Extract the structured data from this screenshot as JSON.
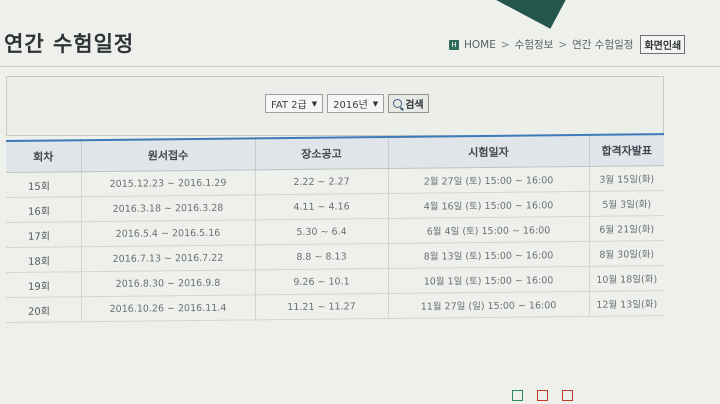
{
  "page": {
    "title": "연간 수험일정"
  },
  "breadcrumb": {
    "home_icon_text": "H",
    "items": [
      "HOME",
      "수험정보",
      "연간 수험일정"
    ],
    "fullscreen_label": "화면인쇄"
  },
  "search": {
    "exam_select": "FAT 2급",
    "year_select": "2016년",
    "button_label": "검색"
  },
  "table": {
    "headers": [
      "회차",
      "원서접수",
      "장소공고",
      "시험일자",
      "합격자발표"
    ],
    "rows": [
      [
        "15회",
        "2015.12.23 ~ 2016.1.29",
        "2.22 ~ 2.27",
        "2월 27일 (토) 15:00 ~ 16:00",
        "3월 15일(화)"
      ],
      [
        "16회",
        "2016.3.18 ~ 2016.3.28",
        "4.11 ~ 4.16",
        "4월 16일 (토) 15:00 ~ 16:00",
        "5월 3일(화)"
      ],
      [
        "17회",
        "2016.5.4 ~ 2016.5.16",
        "5.30 ~ 6.4",
        "6월 4일 (토) 15:00 ~ 16:00",
        "6월 21일(화)"
      ],
      [
        "18회",
        "2016.7.13 ~ 2016.7.22",
        "8.8 ~ 8.13",
        "8월 13일 (토) 15:00 ~ 16:00",
        "8월 30일(화)"
      ],
      [
        "19회",
        "2016.8.30 ~ 2016.9.8",
        "9.26 ~ 10.1",
        "10월 1일 (토) 15:00 ~ 16:00",
        "10월 18일(화)"
      ],
      [
        "20회",
        "2016.10.26 ~ 2016.11.4",
        "11.21 ~ 11.27",
        "11월 27일 (일) 15:00 ~ 16:00",
        "12월 13일(화)"
      ]
    ]
  },
  "footer": {
    "icons": [
      "footer-icon-1",
      "footer-icon-2",
      "footer-icon-3"
    ]
  }
}
